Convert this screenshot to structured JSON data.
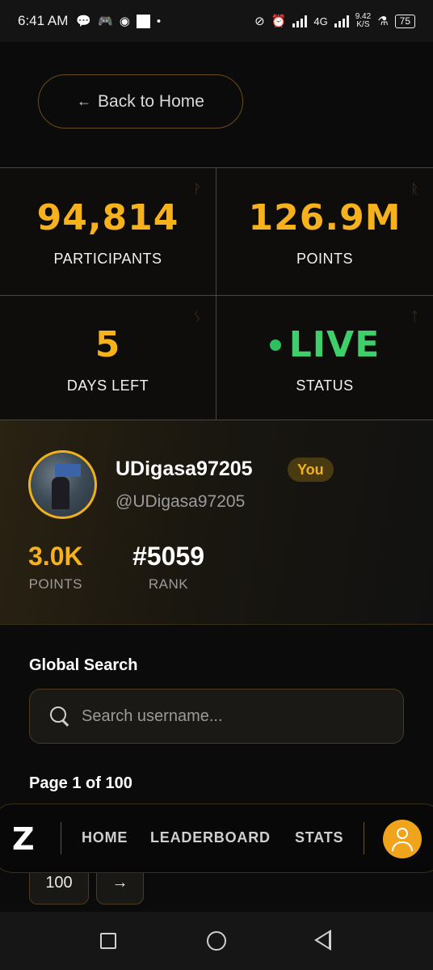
{
  "status_bar": {
    "time": "6:41 AM",
    "network_type": "4G",
    "net_speed_value": "9.42",
    "net_speed_unit": "K/S",
    "battery": "75"
  },
  "header": {
    "back_label": "Back to Home",
    "back_arrow": "←"
  },
  "stats": [
    {
      "value": "94,814",
      "label": "PARTICIPANTS",
      "glyph": "ᚹ"
    },
    {
      "value": "126.9M",
      "label": "POINTS",
      "glyph": "ᚱ"
    },
    {
      "value": "5",
      "label": "DAYS LEFT",
      "glyph": "ᛊ"
    },
    {
      "value": "LIVE",
      "label": "STATUS",
      "glyph": "ᛏ"
    }
  ],
  "profile": {
    "username": "UDigasa97205",
    "badge": "You",
    "handle": "@UDigasa97205",
    "points_value": "3.0K",
    "points_label": "POINTS",
    "rank_value": "#5059",
    "rank_label": "RANK"
  },
  "search": {
    "title": "Global Search",
    "placeholder": "Search username..."
  },
  "pagination": {
    "info": "Page 1 of 100",
    "last_page": "100",
    "next": "→"
  },
  "nav": {
    "items": [
      "HOME",
      "LEADERBOARD",
      "STATS"
    ]
  },
  "colors": {
    "accent": "#f6b21c",
    "live": "#3ecf6a",
    "background": "#0b0b0b",
    "border": "#5c4318"
  }
}
